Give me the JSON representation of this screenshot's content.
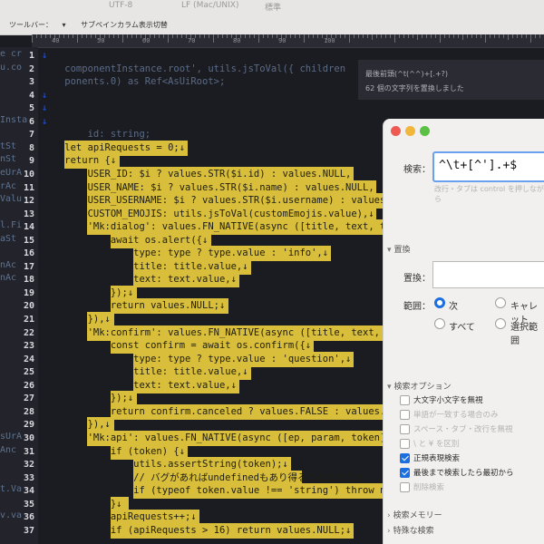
{
  "toolbar": {
    "encoding": "UTF-8",
    "line_endings": "LF (Mac/UNIX)",
    "mode": "標準",
    "label": "ツールバー：",
    "subpane_toggle": "サブペインカラム表示切替"
  },
  "ruler": {
    "numbers": [
      "40",
      "50",
      "60",
      "70",
      "80",
      "90",
      "100"
    ]
  },
  "notice": {
    "line1": "最後前頭(^t(^^)+[.+?)",
    "line2": "62 個の文字列を置換しました"
  },
  "gutter": {
    "numbers": [
      "1",
      "2",
      "3",
      "4",
      "5",
      "6",
      "7",
      "8",
      "9",
      "10",
      "11",
      "12",
      "13",
      "14",
      "15",
      "16",
      "17",
      "18",
      "19",
      "20",
      "21",
      "22",
      "23",
      "24",
      "25",
      "26",
      "27",
      "28",
      "29",
      "30",
      "31",
      "32",
      "33",
      "34",
      "35",
      "36",
      "37"
    ]
  },
  "code": {
    "lines": [
      {
        "text": "↓",
        "hl": false
      },
      {
        "text": "    componentInstance.root', utils.jsToVal({ children",
        "hl": false,
        "ghost": true
      },
      {
        "text": "    ponents.0) as Ref<AsUiRoot>;",
        "hl": false,
        "ghost": true
      },
      {
        "text": "↓",
        "hl": false
      },
      {
        "text": "↓",
        "hl": false
      },
      {
        "text": "↓",
        "hl": false
      },
      {
        "text": "        id: string;",
        "hl": false,
        "ghost": true
      },
      {
        "text": "    let apiRequests = 0;↓",
        "hl": true
      },
      {
        "text": "    return {↓",
        "hl": true
      },
      {
        "text": "        USER_ID: $i ? values.STR($i.id) : values.NULL,",
        "hl": true
      },
      {
        "text": "        USER_NAME: $i ? values.STR($i.name) : values.NULL,",
        "hl": true
      },
      {
        "text": "        USER_USERNAME: $i ? values.STR($i.username) : values.N",
        "hl": true
      },
      {
        "text": "        CUSTOM_EMOJIS: utils.jsToVal(customEmojis.value),↓",
        "hl": true
      },
      {
        "text": "        'Mk:dialog': values.FN_NATIVE(async ([title, text, typ",
        "hl": true
      },
      {
        "text": "            await os.alert({↓",
        "hl": true
      },
      {
        "text": "                type: type ? type.value : 'info',↓",
        "hl": true
      },
      {
        "text": "                title: title.value,↓",
        "hl": true
      },
      {
        "text": "                text: text.value,↓",
        "hl": true
      },
      {
        "text": "            });↓",
        "hl": true
      },
      {
        "text": "            return values.NULL;↓",
        "hl": true
      },
      {
        "text": "        }),↓",
        "hl": true
      },
      {
        "text": "        'Mk:confirm': values.FN_NATIVE(async ([title, text, ty",
        "hl": true
      },
      {
        "text": "            const confirm = await os.confirm({↓",
        "hl": true
      },
      {
        "text": "                type: type ? type.value : 'question',↓",
        "hl": true
      },
      {
        "text": "                title: title.value,↓",
        "hl": true
      },
      {
        "text": "                text: text.value,↓",
        "hl": true
      },
      {
        "text": "            });↓",
        "hl": true
      },
      {
        "text": "            return confirm.canceled ? values.FALSE : values.TR",
        "hl": true
      },
      {
        "text": "        }),↓",
        "hl": true
      },
      {
        "text": "        'Mk:api': values.FN_NATIVE(async ([ep, param, token])",
        "hl": true
      },
      {
        "text": "            if (token) {↓",
        "hl": true
      },
      {
        "text": "                utils.assertString(token);↓",
        "hl": true
      },
      {
        "text": "                // バグがあればundefinedもあり得るため念のため",
        "hl": true
      },
      {
        "text": "                if (typeof token.value !== 'string') throw ne",
        "hl": true
      },
      {
        "text": "            }↓",
        "hl": true
      },
      {
        "text": "            apiRequests++;↓",
        "hl": true
      },
      {
        "text": "            if (apiRequests > 16) return values.NULL;↓",
        "hl": true
      }
    ]
  },
  "side_ghost": [
    "e cr",
    "u.co",
    "",
    "",
    "",
    "Insta",
    "",
    "tSt",
    "nSt",
    "eUrA",
    "rAc",
    "Valu",
    "",
    "l.Fi",
    "aSt",
    "",
    "nAc",
    "nAc",
    "",
    "",
    "",
    "",
    "",
    "",
    "",
    "",
    "",
    "",
    "",
    "sUrA",
    "Anc",
    "",
    "",
    "t.Va",
    "",
    "v.va",
    ""
  ],
  "find_panel": {
    "search_label": "検索：",
    "search_value": "^\\t+[^'].+$",
    "hint": "改行・タブは control を押しながら",
    "replace_section": "置換",
    "replace_label": "置換：",
    "range_label": "範囲：",
    "range_options": [
      "次",
      "キャレット",
      "すべて",
      "選択範囲"
    ],
    "options_section": "検索オプション",
    "options": [
      {
        "label": "大文字小文字を無視",
        "checked": false,
        "enabled": true
      },
      {
        "label": "単語が一致する場合のみ",
        "checked": false,
        "enabled": false
      },
      {
        "label": "スペース・タブ・改行を無視",
        "checked": false,
        "enabled": false
      },
      {
        "label": "\\ と ¥ を区別",
        "checked": false,
        "enabled": false
      },
      {
        "label": "正規表現検索",
        "checked": true,
        "enabled": true
      },
      {
        "label": "最後まで検索したら最初から",
        "checked": true,
        "enabled": true
      },
      {
        "label": "削除検索",
        "checked": false,
        "enabled": false
      }
    ],
    "memory_section": "検索メモリー",
    "special_section": "特殊な検索"
  },
  "colors": {
    "highlight": "#d8be3a",
    "arrow": "#1a47d8",
    "accent": "#1c6fe0"
  }
}
